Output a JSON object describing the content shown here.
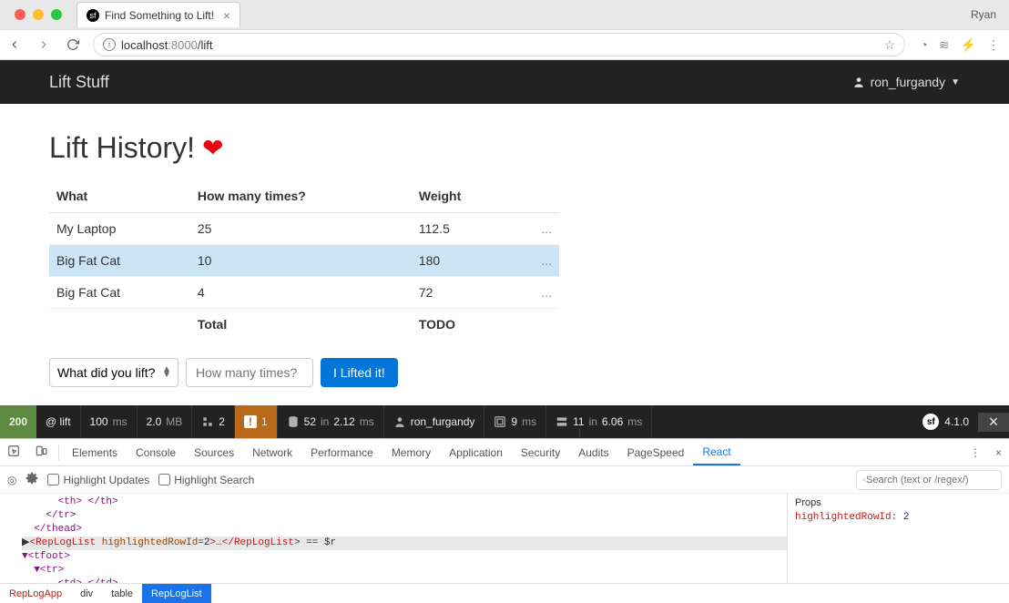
{
  "browser": {
    "tab_title": "Find Something to Lift!",
    "profile": "Ryan",
    "url_host": "localhost",
    "url_port": ":8000",
    "url_path": "/lift"
  },
  "navbar": {
    "brand": "Lift Stuff",
    "user": "ron_furgandy"
  },
  "page": {
    "title": "Lift History!",
    "columns": {
      "what": "What",
      "times": "How many times?",
      "weight": "Weight"
    },
    "rows": [
      {
        "what": "My Laptop",
        "times": "25",
        "weight": "112.5",
        "highlighted": false
      },
      {
        "what": "Big Fat Cat",
        "times": "10",
        "weight": "180",
        "highlighted": true
      },
      {
        "what": "Big Fat Cat",
        "times": "4",
        "weight": "72",
        "highlighted": false
      }
    ],
    "footer": {
      "label": "Total",
      "value": "TODO"
    },
    "form": {
      "select_placeholder": "What did you lift?",
      "input_placeholder": "How many times?",
      "submit": "I Lifted it!"
    },
    "row_action": "..."
  },
  "sf_toolbar": {
    "status": "200",
    "route": "@ lift",
    "time": "100",
    "mem": "2.0",
    "ajax": "2",
    "errors": "1",
    "db_count": "52",
    "db_time": "2.12",
    "user": "ron_furgandy",
    "twig": "9",
    "cache_count": "11",
    "cache_time": "6.06",
    "version": "4.1.0"
  },
  "devtools": {
    "tabs": [
      "Elements",
      "Console",
      "Sources",
      "Network",
      "Performance",
      "Memory",
      "Application",
      "Security",
      "Audits",
      "PageSpeed",
      "React"
    ],
    "active_tab": "React",
    "highlight_updates": "Highlight Updates",
    "highlight_search": "Highlight Search",
    "search_placeholder": "Search (text or /regex/)",
    "tree": {
      "line1": "      <th> </th>",
      "line2": "    </tr>",
      "line3": "  </thead>",
      "line4_pre": "▶",
      "line4_comp": "<RepLogList ",
      "line4_attr": "highlightedRowId",
      "line4_val": "2",
      "line4_mid": ">…</",
      "line4_comp2": "RepLogList",
      "line4_post": "> == $r",
      "line5": "▼<tfoot>",
      "line6": "  ▼<tr>",
      "line7": "      <td> </td>"
    },
    "props": {
      "title": "Props",
      "key": "highlightedRowId:",
      "value": "2"
    },
    "crumbs": [
      "RepLogApp",
      "div",
      "table",
      "RepLogList"
    ]
  }
}
